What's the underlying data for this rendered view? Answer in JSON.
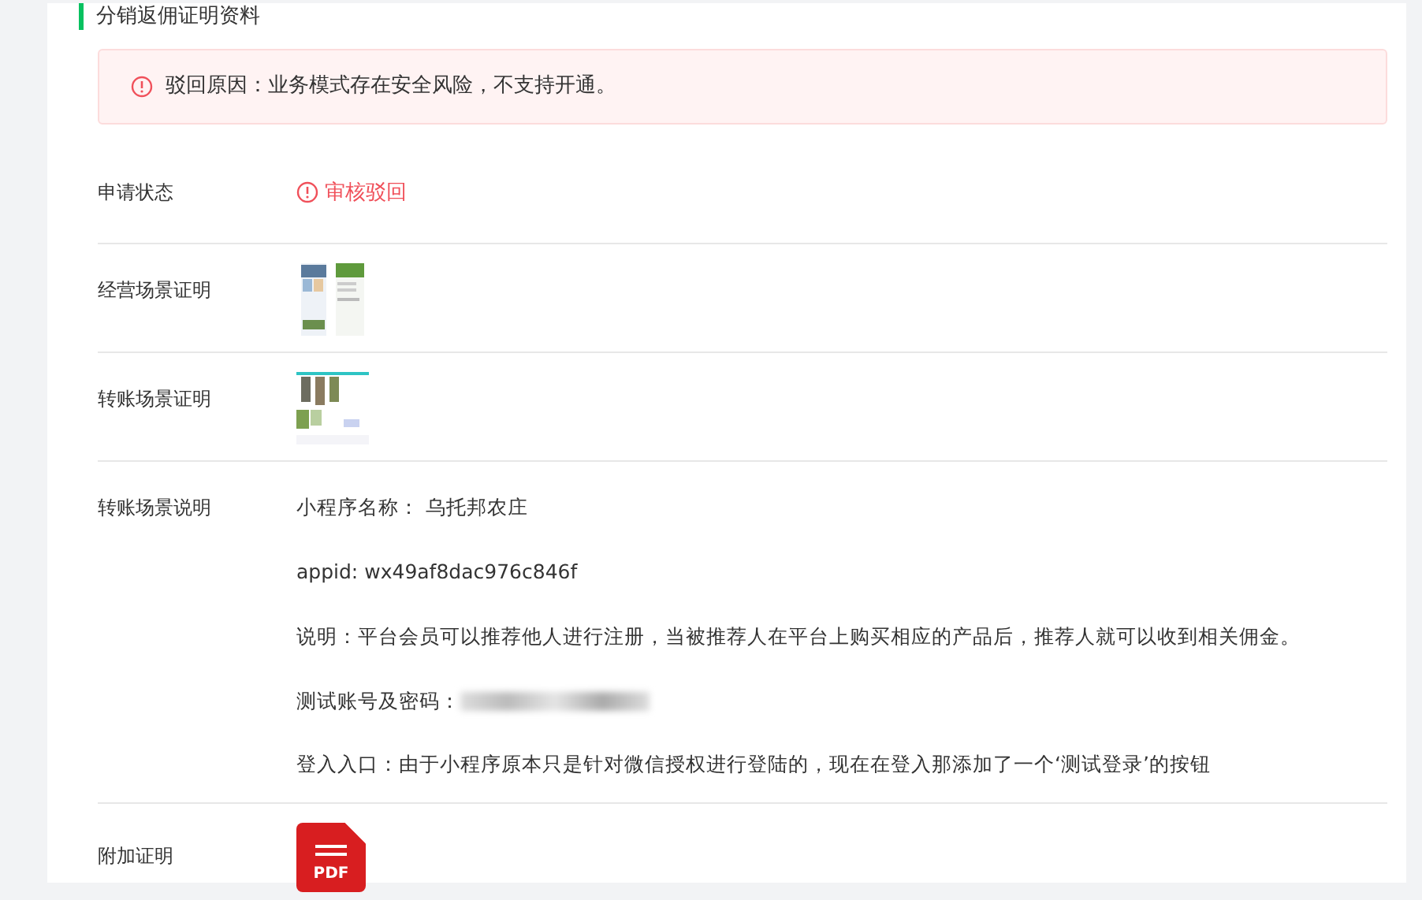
{
  "section": {
    "title": "分销返佣证明资料"
  },
  "alert": {
    "text": "驳回原因：业务模式存在安全风险，不支持开通。"
  },
  "rows": [
    {
      "kind": "status",
      "label": "申请状态",
      "value": "审核驳回"
    },
    {
      "kind": "images",
      "label": "经营场景证明"
    },
    {
      "kind": "images",
      "label": "转账场景证明"
    },
    {
      "kind": "lines",
      "label": "转账场景说明",
      "lines": [
        {
          "text": "小程序名称：  乌托邦农庄",
          "redacted": false
        },
        {
          "text": "appid: wx49af8dac976c846f",
          "redacted": false
        },
        {
          "text": "说明：平台会员可以推荐他人进行注册，当被推荐人在平台上购买相应的产品后，推荐人就可以收到相关佣金。",
          "redacted": false
        },
        {
          "text": "测试账号及密码：",
          "redacted": true
        },
        {
          "text": "登入入口：由于小程序原本只是针对微信授权进行登陆的，现在在登入那添加了一个‘测试登录’的按钮",
          "redacted": false
        }
      ]
    },
    {
      "kind": "file",
      "label": "附加证明",
      "file_type": "PDF"
    }
  ]
}
